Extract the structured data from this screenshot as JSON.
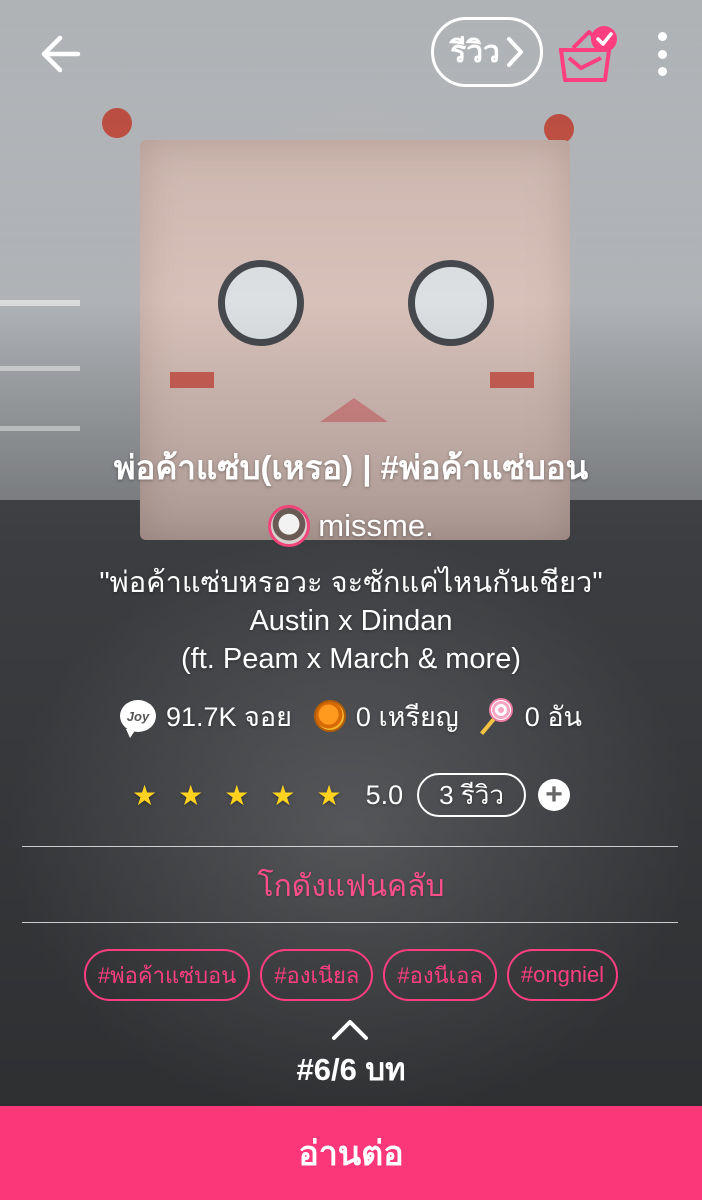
{
  "header": {
    "review_label": "รีวิว"
  },
  "story": {
    "title": "พ่อค้าแซ่บ(เหรอ) | #พ่อค้าแซ่บอน",
    "author": "missme.",
    "tagline": "\"พ่อค้าแซ่บหรอวะ จะซักแค่ไหนกันเชียว\"",
    "description_lines": [
      "Austin x Dindan",
      "(ft. Peam x March & more)"
    ]
  },
  "stats": {
    "joy_icon_text": "Joy",
    "joy": "91.7K จอย",
    "coins": "0 เหรียญ",
    "candy": "0 อัน"
  },
  "rating": {
    "stars": 5,
    "value": "5.0",
    "review_count_label": "3 รีวิว"
  },
  "fanclub_label": "โกดังแฟนคลับ",
  "tags": [
    "#พ่อค้าแซ่บอน",
    "#องเนียล",
    "#องนีเอล",
    "#ongniel"
  ],
  "chapter_label": "#6/6 บท",
  "read_button_label": "อ่านต่อ",
  "colors": {
    "accent": "#fb3679",
    "tag": "#ff3e7f",
    "star": "#ffd21f"
  },
  "icons": {
    "back": "arrow-left-icon",
    "review_chevron": "chevron-right-icon",
    "shelf": "bookshelf-check-icon",
    "more": "more-vertical-icon",
    "joy": "joy-bubble-icon",
    "coin": "coin-icon",
    "candy": "lollipop-icon",
    "star": "star-icon",
    "add": "plus-circle-icon",
    "expand": "chevron-up-icon"
  }
}
